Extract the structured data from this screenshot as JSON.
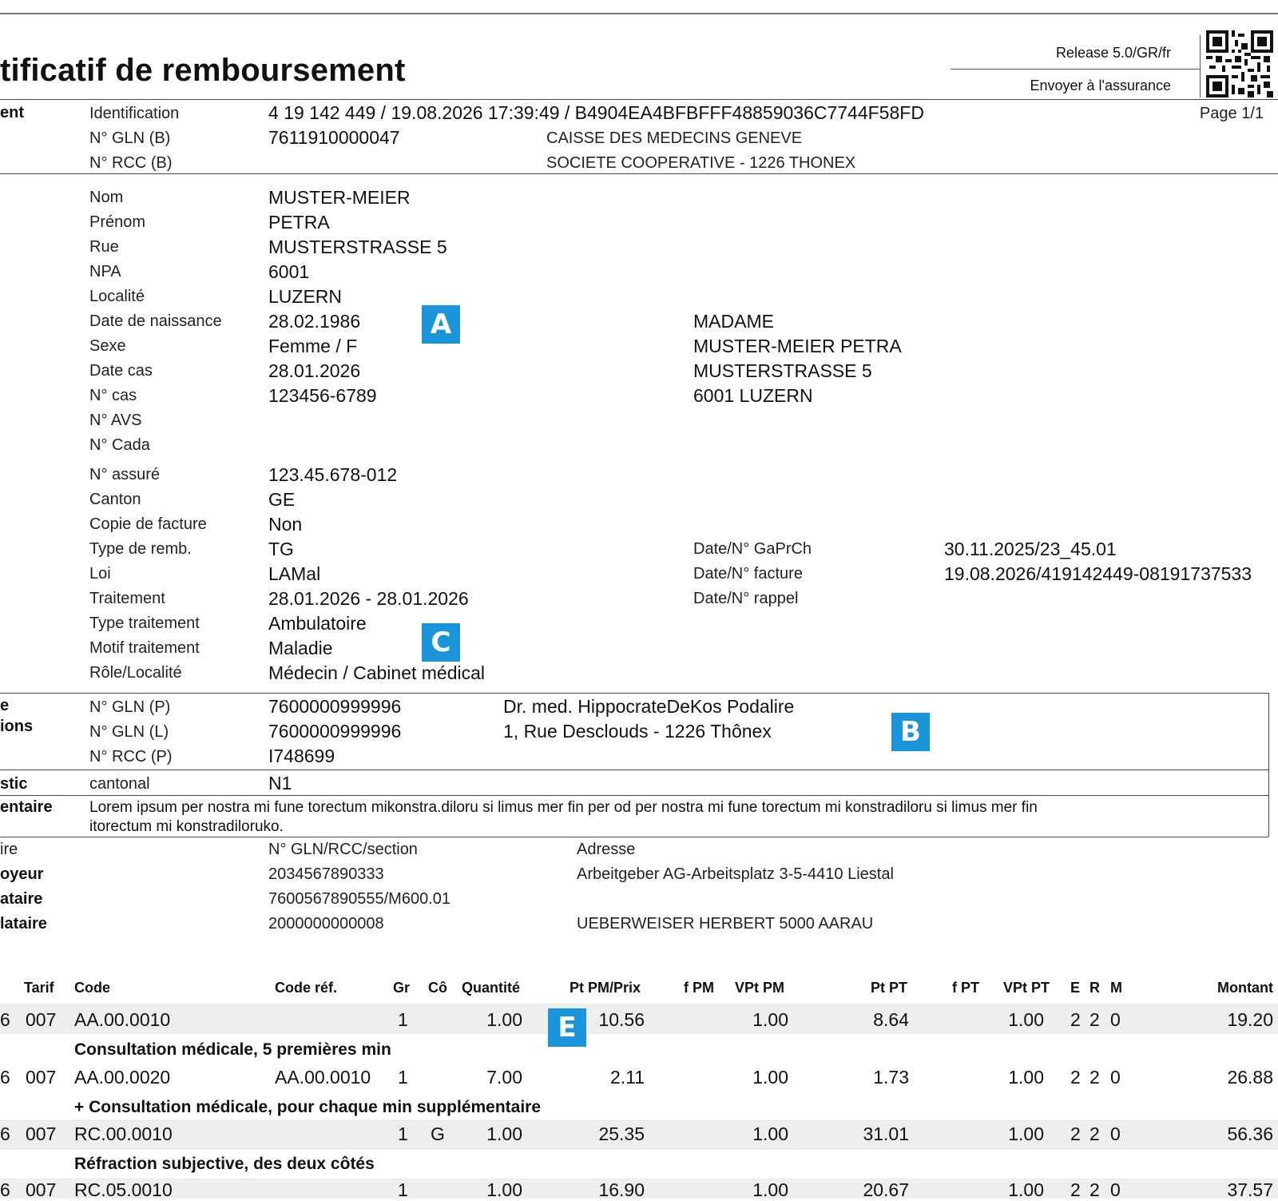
{
  "doc": {
    "title": "tificatif de remboursement",
    "release": "Release 5.0/GR/fr",
    "send_to": "Envoyer à l'assurance",
    "page": "Page 1/1"
  },
  "sections": {
    "s1": "ent",
    "s2": "e",
    "s3": "ions",
    "s4": "stic",
    "s5": "entaire",
    "s6": "ire",
    "s7": "oyeur",
    "s8": "ataire",
    "s9": "lataire"
  },
  "header_fields": [
    {
      "label": "Identification",
      "value": "4 19 142 449 / 19.08.2026 17:39:49 / B4904EA4BFBFFF48859036C7744F58FD"
    },
    {
      "label": "N° GLN (B)",
      "value": "7611910000047",
      "extra": "CAISSE DES MEDECINS GENEVE"
    },
    {
      "label": "N° RCC (B)",
      "value": "",
      "extra": "SOCIETE COOPERATIVE - 1226 THONEX"
    }
  ],
  "patient_fields": [
    {
      "label": "Nom",
      "value": "MUSTER-MEIER"
    },
    {
      "label": "Prénom",
      "value": "PETRA"
    },
    {
      "label": "Rue",
      "value": "MUSTERSTRASSE 5"
    },
    {
      "label": "NPA",
      "value": "6001"
    },
    {
      "label": "Localité",
      "value": "LUZERN"
    },
    {
      "label": "Date de naissance",
      "value": "28.02.1986"
    },
    {
      "label": "Sexe",
      "value": "Femme / F"
    },
    {
      "label": "Date cas",
      "value": "28.01.2026"
    },
    {
      "label": "N° cas",
      "value": "123456-6789"
    },
    {
      "label": "N° AVS",
      "value": ""
    },
    {
      "label": "N° Cada",
      "value": ""
    },
    {
      "label": "N° assuré",
      "value": "123.45.678-012"
    },
    {
      "label": "Canton",
      "value": "GE"
    },
    {
      "label": "Copie de facture",
      "value": "Non"
    },
    {
      "label": "Type de remb.",
      "value": "TG"
    },
    {
      "label": "Loi",
      "value": "LAMal"
    },
    {
      "label": "Traitement",
      "value": "28.01.2026 - 28.01.2026"
    },
    {
      "label": "Type traitement",
      "value": "Ambulatoire"
    },
    {
      "label": "Motif traitement",
      "value": "Maladie"
    },
    {
      "label": "Rôle/Localité",
      "value": "Médecin / Cabinet médical"
    }
  ],
  "address_block": [
    "MADAME",
    "MUSTER-MEIER PETRA",
    "MUSTERSTRASSE 5",
    "6001 LUZERN"
  ],
  "dates": [
    {
      "label": "Date/N° GaPrCh",
      "value": "30.11.2025/23_45.01"
    },
    {
      "label": "Date/N° facture",
      "value": "19.08.2026/419142449-08191737533"
    },
    {
      "label": "Date/N° rappel",
      "value": ""
    }
  ],
  "provider_fields": [
    {
      "label": "N° GLN (P)",
      "value": "7600000999996",
      "extra": "Dr. med. HippocrateDeKos Podalire"
    },
    {
      "label": "N° GLN (L)",
      "value": "7600000999996",
      "extra": "1, Rue Desclouds - 1226 Thônex"
    },
    {
      "label": "N° RCC (P)",
      "value": "I748699"
    }
  ],
  "diagnostic": {
    "label": "cantonal",
    "value": "N1"
  },
  "comment": {
    "line1": "Lorem ipsum per nostra mi fune torectum mikonstra.diloru si limus mer fin per od     per nostra mi fune torectum mi konstradiloru si limus mer fin",
    "line2": "itorectum mi     konstradiloruko."
  },
  "parties": {
    "col_gln": "N° GLN/RCC/section",
    "col_addr": "Adresse",
    "rows": [
      {
        "gln": "2034567890333",
        "addr": "Arbeitgeber AG-Arbeitsplatz 3-5-4410 Liestal"
      },
      {
        "gln": "7600567890555/M600.01",
        "addr": ""
      },
      {
        "gln": "2000000000008",
        "addr": "UEBERWEISER HERBERT 5000 AARAU"
      }
    ]
  },
  "markers": {
    "a": "A",
    "b": "B",
    "c": "C",
    "e": "E"
  },
  "table": {
    "headers": {
      "tarif": "Tarif",
      "code": "Code",
      "coderef": "Code réf.",
      "gr": "Gr",
      "co": "Cô",
      "qty": "Quantité",
      "ptpm": "Pt PM/Prix",
      "fpm": "f PM",
      "vptpm": "VPt PM",
      "ptpt": "Pt PT",
      "fpt": "f PT",
      "vptpt": "VPt PT",
      "e": "E",
      "r": "R",
      "m": "M",
      "montant": "Montant"
    },
    "rows": [
      {
        "pre": "6",
        "tarif": "007",
        "code": "AA.00.0010",
        "coderef": "",
        "gr": "1",
        "co": "",
        "qty": "1.00",
        "ptpm": "10.56",
        "vptpm": "1.00",
        "ptpt": "8.64",
        "vptpt": "1.00",
        "e": "2",
        "r": "2",
        "m": "0",
        "montant": "19.20",
        "desc": "Consultation médicale, 5 premières min"
      },
      {
        "pre": "6",
        "tarif": "007",
        "code": "AA.00.0020",
        "coderef": "AA.00.0010",
        "gr": "1",
        "co": "",
        "qty": "7.00",
        "ptpm": "2.11",
        "vptpm": "1.00",
        "ptpt": "1.73",
        "vptpt": "1.00",
        "e": "2",
        "r": "2",
        "m": "0",
        "montant": "26.88",
        "desc": "+ Consultation médicale, pour chaque min supplémentaire"
      },
      {
        "pre": "6",
        "tarif": "007",
        "code": "RC.00.0010",
        "coderef": "",
        "gr": "1",
        "co": "G",
        "qty": "1.00",
        "ptpm": "25.35",
        "vptpm": "1.00",
        "ptpt": "31.01",
        "vptpt": "1.00",
        "e": "2",
        "r": "2",
        "m": "0",
        "montant": "56.36",
        "desc": "Réfraction subjective, des deux côtés"
      },
      {
        "pre": "6",
        "tarif": "007",
        "code": "RC.05.0010",
        "coderef": "",
        "gr": "1",
        "co": "",
        "qty": "1.00",
        "ptpm": "16.90",
        "vptpm": "1.00",
        "ptpt": "20.67",
        "vptpt": "1.00",
        "e": "2",
        "r": "2",
        "m": "0",
        "montant": "37.57",
        "desc": ""
      }
    ]
  }
}
